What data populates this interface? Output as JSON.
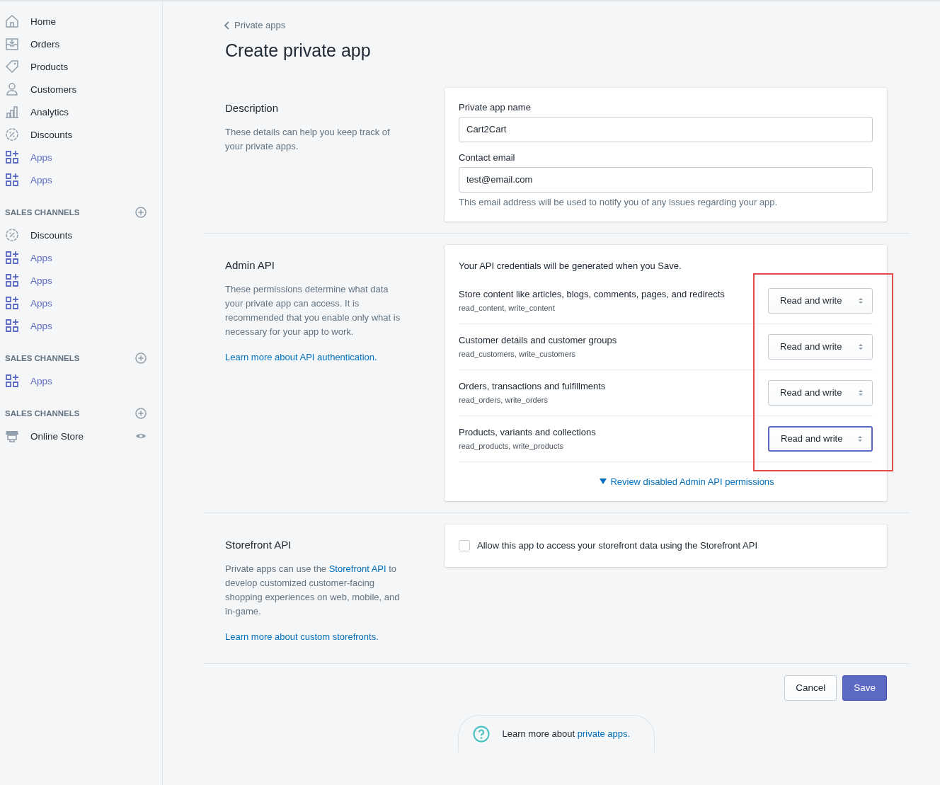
{
  "sidebar": {
    "items": [
      {
        "kind": "home",
        "label": "Home",
        "active": false
      },
      {
        "kind": "orders",
        "label": "Orders",
        "active": false
      },
      {
        "kind": "products",
        "label": "Products",
        "active": false
      },
      {
        "kind": "customers",
        "label": "Customers",
        "active": false
      },
      {
        "kind": "analytics",
        "label": "Analytics",
        "active": false
      },
      {
        "kind": "discounts",
        "label": "Discounts",
        "active": false
      },
      {
        "kind": "apps",
        "label": "Apps",
        "active": true
      },
      {
        "kind": "apps",
        "label": "Apps",
        "active": true
      },
      {
        "kind": "heading",
        "label": "SALES CHANNELS"
      },
      {
        "kind": "discounts",
        "label": "Discounts",
        "active": false
      },
      {
        "kind": "apps",
        "label": "Apps",
        "active": true
      },
      {
        "kind": "apps",
        "label": "Apps",
        "active": true
      },
      {
        "kind": "apps",
        "label": "Apps",
        "active": true
      },
      {
        "kind": "apps",
        "label": "Apps",
        "active": true
      },
      {
        "kind": "heading",
        "label": "SALES CHANNELS"
      },
      {
        "kind": "apps",
        "label": "Apps",
        "active": true
      },
      {
        "kind": "heading",
        "label": "SALES CHANNELS"
      },
      {
        "kind": "store",
        "label": "Online Store",
        "active": false
      }
    ]
  },
  "breadcrumb": "Private apps",
  "title": "Create private app",
  "description": {
    "heading": "Description",
    "text": "These details can help you keep track of your private apps.",
    "fields": [
      {
        "label": "Private app name",
        "value": "Cart2Cart"
      },
      {
        "label": "Contact email",
        "value": "test@email.com",
        "help": "This email address will be used to notify you of any issues regarding your app."
      }
    ]
  },
  "admin_api": {
    "heading": "Admin API",
    "text": "These permissions determine what data your private app can access. It is recommended that you enable only what is necessary for your app to work.",
    "link": "Learn more about API authentication.",
    "intro": "Your API credentials will be generated when you Save.",
    "permissions": [
      {
        "name": "Store content like articles, blogs, comments, pages, and redirects",
        "scopes": "read_content, write_content",
        "access": "Read and write",
        "focused": false
      },
      {
        "name": "Customer details and customer groups",
        "scopes": "read_customers, write_customers",
        "access": "Read and write",
        "focused": false
      },
      {
        "name": "Orders, transactions and fulfillments",
        "scopes": "read_orders, write_orders",
        "access": "Read and write",
        "focused": false
      },
      {
        "name": "Products, variants and collections",
        "scopes": "read_products, write_products",
        "access": "Read and write",
        "focused": true
      }
    ],
    "review_link": "Review disabled Admin API permissions"
  },
  "storefront_api": {
    "heading": "Storefront API",
    "text_before": "Private apps can use the",
    "text_link": "Storefront API",
    "text_after": "to develop customized customer-facing shopping experiences on web, mobile, and in-game.",
    "link": "Learn more about custom storefronts.",
    "checkbox": {
      "label": "Allow this app to access your storefront data using the Storefront API",
      "checked": false
    }
  },
  "buttons": {
    "cancel": "Cancel",
    "save": "Save"
  },
  "footer": {
    "text": "Learn more about",
    "link": "private apps."
  }
}
